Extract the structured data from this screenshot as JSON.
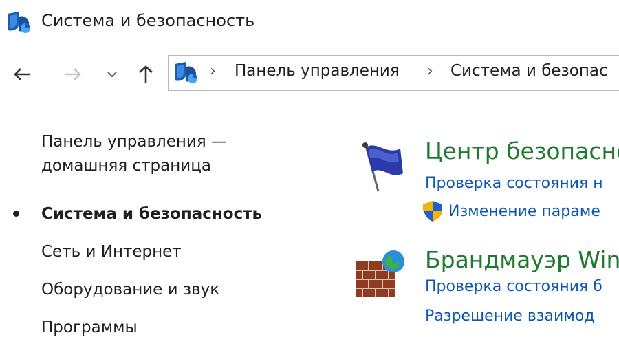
{
  "window": {
    "title": "Система и безопасность"
  },
  "nav": {
    "back_icon": "arrow-left-icon",
    "forward_icon": "arrow-right-icon",
    "history_icon": "chevron-down-icon",
    "up_icon": "arrow-up-icon"
  },
  "address": {
    "crumbs": [
      "Панель управления",
      "Система и безопас"
    ]
  },
  "sidebar": {
    "home_line1": "Панель управления —",
    "home_line2": "домашняя страница",
    "items": [
      {
        "label": "Система и безопасность",
        "current": true
      },
      {
        "label": "Сеть и Интернет"
      },
      {
        "label": "Оборудование и звук"
      },
      {
        "label": "Программы"
      }
    ]
  },
  "sections": [
    {
      "heading": "Центр безопасно",
      "icon": "flag-icon",
      "links": [
        "Проверка состояния н",
        "Изменение параме"
      ]
    },
    {
      "heading": "Брандмауэр Win",
      "icon": "firewall-icon",
      "links": [
        "Проверка состояния б",
        "Разрешение взаимод"
      ]
    }
  ],
  "colors": {
    "heading": "#1e7a2e",
    "link": "#0b57b5",
    "text": "#1f1f1f"
  }
}
